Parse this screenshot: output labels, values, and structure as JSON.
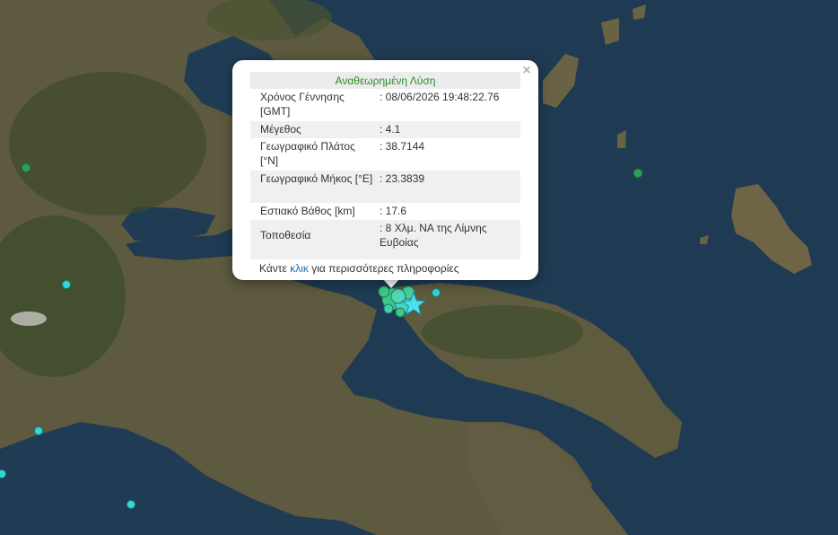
{
  "popup": {
    "header": "Αναθεωρημένη Λύση",
    "close_symbol": "×",
    "rows": [
      {
        "label": "Χρόνος Γέννησης [GMT]",
        "value": ": 08/06/2026 19:48:22.76"
      },
      {
        "label": "Μέγεθος",
        "value": ": 4.1"
      },
      {
        "label": "Γεωγραφικό Πλάτος [°N]",
        "value": ": 38.7144"
      },
      {
        "label": "Γεωγραφικό Μήκος [°E]",
        "value": ": 23.3839"
      },
      {
        "label": "Εστιακό Βάθος [km]",
        "value": ": 17.6"
      },
      {
        "label": "Τοποθεσία",
        "value": ": 8 Χλμ. ΝΑ της Λίμνης Ευβοίας"
      }
    ],
    "more_prefix": "Κάντε ",
    "more_link": "κλικ",
    "more_suffix": " για περισσότερες πληροφορίες"
  },
  "colors": {
    "sea": "#1e3a52",
    "land": "#5e5a3e",
    "forest": "#3f4a2c",
    "green_marker": "#2e9e5a",
    "cyan_marker": "#35d6d6",
    "star": "#4fe0f0"
  }
}
